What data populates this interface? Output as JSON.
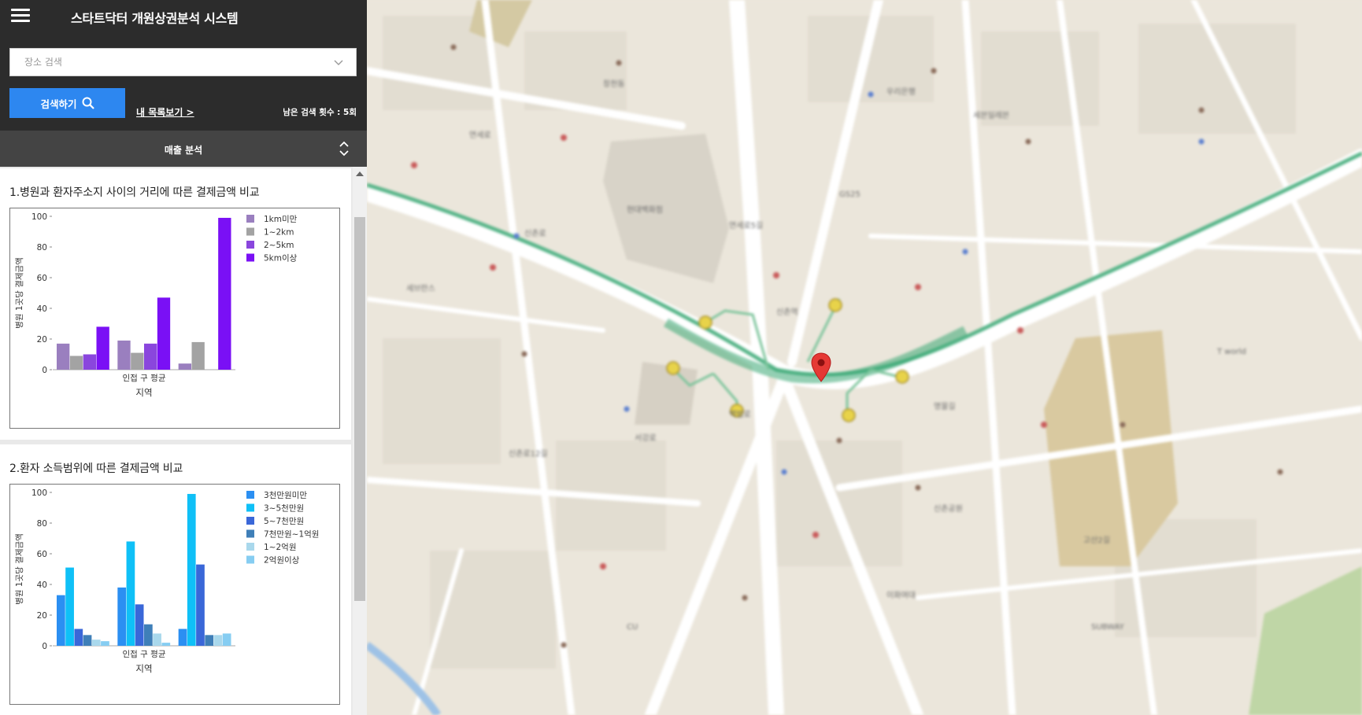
{
  "header": {
    "title": "스타트닥터 개원상권분석 시스템",
    "search_placeholder": "장소 검색",
    "search_button": "검색하기",
    "my_list_link": "내 목록보기 >",
    "remaining_label": "남은 검색 횟수 : 5회"
  },
  "section": {
    "title": "매출 분석"
  },
  "colors": {
    "header_bg": "#2c2c2c",
    "section_bg": "#444444",
    "accent": "#2d87f0",
    "route": "#3aa874",
    "map_bg": "#ebe6db",
    "marker": "#e53935"
  },
  "charts": [
    {
      "title": "1.병원과 환자주소지 사이의 거리에 따른 결제금액 비교",
      "chart_data": {
        "type": "bar",
        "categories": [
          "",
          "인접 구 평균",
          ""
        ],
        "series": [
          {
            "name": "1km미만",
            "color": "#9a7fbf",
            "values": [
              17,
              19,
              4
            ]
          },
          {
            "name": "1~2km",
            "color": "#a3a3a3",
            "values": [
              9,
              11,
              18
            ]
          },
          {
            "name": "2~5km",
            "color": "#8a46dd",
            "values": [
              10,
              17,
              null
            ]
          },
          {
            "name": "5km이상",
            "color": "#7a10f5",
            "values": [
              28,
              47,
              99
            ]
          }
        ],
        "xlabel": "지역",
        "ylabel": "병원 1곳당 결제금액",
        "yticks": [
          "0",
          "20",
          "40",
          "60",
          "80",
          "100"
        ],
        "ylim": [
          0,
          100
        ],
        "legend": "right"
      }
    },
    {
      "title": "2.환자 소득범위에 따른 결제금액 비교",
      "chart_data": {
        "type": "bar",
        "categories": [
          "",
          "인접 구 평균",
          ""
        ],
        "series": [
          {
            "name": "3천만원미만",
            "color": "#2b8ff2",
            "values": [
              33,
              38,
              11
            ]
          },
          {
            "name": "3~5천만원",
            "color": "#0fc0f7",
            "values": [
              51,
              68,
              99
            ]
          },
          {
            "name": "5~7천만원",
            "color": "#3a67d8",
            "values": [
              11,
              27,
              53
            ]
          },
          {
            "name": "7천만원~1억원",
            "color": "#3f7fb8",
            "values": [
              7,
              14,
              7
            ]
          },
          {
            "name": "1~2억원",
            "color": "#a9d8ec",
            "values": [
              4,
              8,
              7
            ]
          },
          {
            "name": "2억원이상",
            "color": "#86cdf2",
            "values": [
              3,
              2,
              8
            ]
          }
        ],
        "xlabel": "지역",
        "ylabel": "병원 1곳당 결제금액",
        "yticks": [
          "0",
          "20",
          "40",
          "60",
          "80",
          "100"
        ],
        "ylim": [
          0,
          100
        ],
        "legend": "right"
      }
    }
  ],
  "map": {
    "labels": [
      "연세로",
      "신촌로",
      "신촌역",
      "서강로",
      "백범로",
      "창천동",
      "GS25",
      "CU",
      "현대백화점",
      "세븐일레븐",
      "연세로5길",
      "신촌로12길",
      "이화여대",
      "T world",
      "SUBWAY",
      "고산2길",
      "명물길",
      "우리은행",
      "세브란스",
      "신촌공원"
    ]
  }
}
